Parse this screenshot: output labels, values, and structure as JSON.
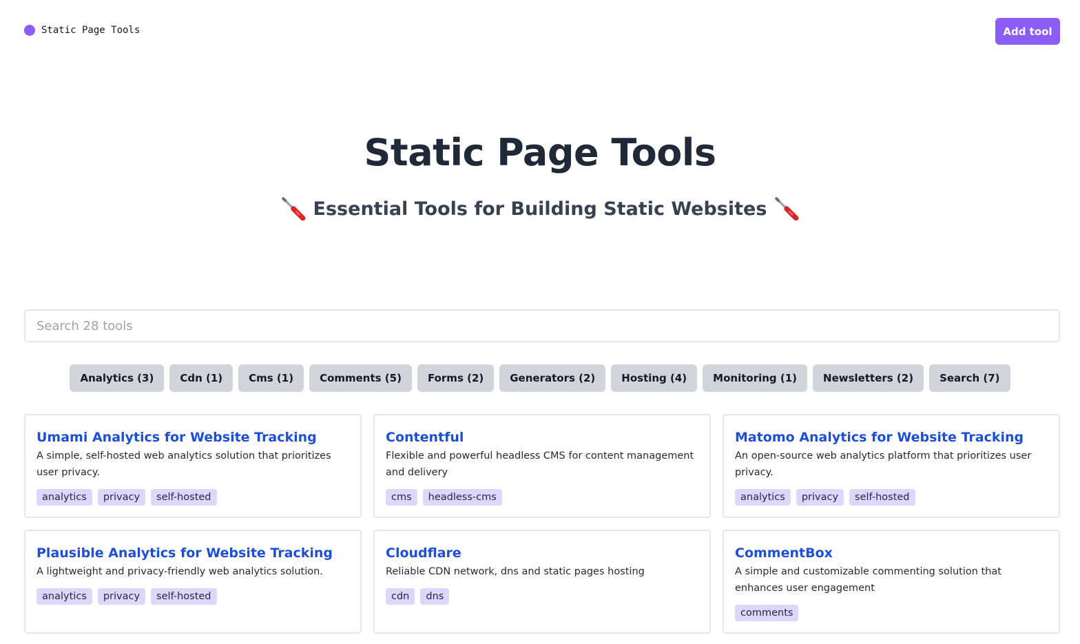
{
  "nav": {
    "brand_name": "Static Page Tools",
    "add_button": "Add tool",
    "accent_color": "#8b5cf6"
  },
  "hero": {
    "title": "Static Page Tools",
    "subtitle": "Essential Tools for Building Static Websites",
    "icon": "screwdriver-icon"
  },
  "search": {
    "placeholder": "Search 28 tools",
    "value": ""
  },
  "categories": [
    "Analytics (3)",
    "Cdn (1)",
    "Cms (1)",
    "Comments (5)",
    "Forms (2)",
    "Generators (2)",
    "Hosting (4)",
    "Monitoring (1)",
    "Newsletters (2)",
    "Search (7)"
  ],
  "tools": [
    {
      "title": "Umami Analytics for Website Tracking",
      "description": "A simple, self-hosted web analytics solution that prioritizes user privacy.",
      "tags": [
        "analytics",
        "privacy",
        "self-hosted"
      ]
    },
    {
      "title": "Contentful",
      "description": "Flexible and powerful headless CMS for content management and delivery",
      "tags": [
        "cms",
        "headless-cms"
      ]
    },
    {
      "title": "Matomo Analytics for Website Tracking",
      "description": "An open-source web analytics platform that prioritizes user privacy.",
      "tags": [
        "analytics",
        "privacy",
        "self-hosted"
      ]
    },
    {
      "title": "Plausible Analytics for Website Tracking",
      "description": "A lightweight and privacy-friendly web analytics solution.",
      "tags": [
        "analytics",
        "privacy",
        "self-hosted"
      ]
    },
    {
      "title": "Cloudflare",
      "description": "Reliable CDN network, dns and static pages hosting",
      "tags": [
        "cdn",
        "dns"
      ]
    },
    {
      "title": "CommentBox",
      "description": "A simple and customizable commenting solution that enhances user engagement",
      "tags": [
        "comments"
      ]
    }
  ]
}
